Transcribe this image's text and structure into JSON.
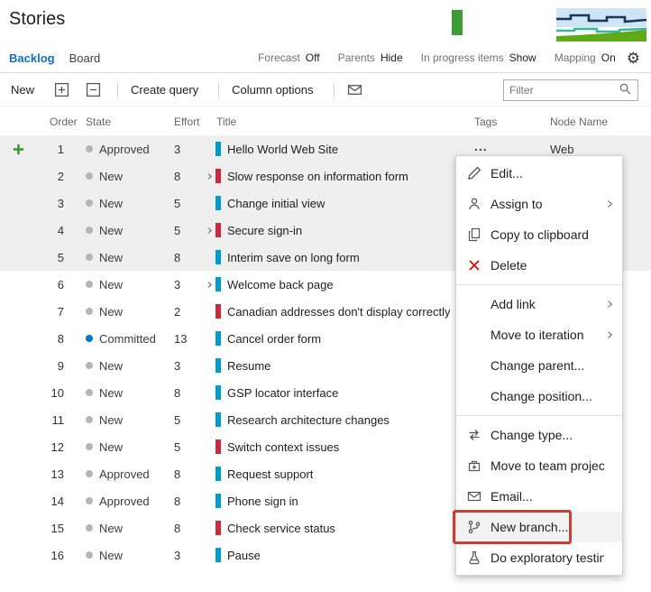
{
  "header": {
    "title": "Stories",
    "tabs": [
      {
        "label": "Backlog",
        "active": true
      },
      {
        "label": "Board",
        "active": false
      }
    ],
    "view_options": [
      {
        "label": "Forecast",
        "value": "Off"
      },
      {
        "label": "Parents",
        "value": "Hide"
      },
      {
        "label": "In progress items",
        "value": "Show"
      },
      {
        "label": "Mapping",
        "value": "On"
      }
    ],
    "gear_icon": "settings-gear-icon",
    "mini_charts": [
      {
        "name": "velocity-mini-chart",
        "bar_color": "#3f9c35"
      },
      {
        "name": "cumulative-flow-mini-chart",
        "colors": [
          "#cfe4f5",
          "#16365c",
          "#33b8a0",
          "#60a917"
        ]
      }
    ]
  },
  "toolbar": {
    "items": [
      {
        "kind": "button",
        "label": "New",
        "name": "new-button"
      },
      {
        "kind": "icon",
        "glyph": "plus-box",
        "name": "expand-all-icon"
      },
      {
        "kind": "icon",
        "glyph": "minus-box",
        "name": "collapse-all-icon"
      },
      {
        "kind": "sep"
      },
      {
        "kind": "button",
        "label": "Create query",
        "name": "create-query-button"
      },
      {
        "kind": "sep"
      },
      {
        "kind": "button",
        "label": "Column options",
        "name": "column-options-button"
      },
      {
        "kind": "sep"
      },
      {
        "kind": "icon",
        "glyph": "email",
        "name": "email-icon"
      }
    ],
    "filter_placeholder": "Filter",
    "search_icon": "search-icon"
  },
  "grid": {
    "columns": [
      "Order",
      "State",
      "Effort",
      "Title",
      "Tags",
      "Node Name"
    ],
    "menu_trigger_label": "...",
    "rows": [
      {
        "order": "1",
        "state": "Approved",
        "state_kind": "gray",
        "effort": "3",
        "title": "Hello World Web Site",
        "type": "story",
        "expand": false,
        "selected": true,
        "node": "Web",
        "add_icon": true,
        "menu_trigger": true
      },
      {
        "order": "2",
        "state": "New",
        "state_kind": "gray",
        "effort": "8",
        "title": "Slow response on information form",
        "type": "bug",
        "expand": true,
        "selected": true
      },
      {
        "order": "3",
        "state": "New",
        "state_kind": "gray",
        "effort": "5",
        "title": "Change initial view",
        "type": "story",
        "expand": false,
        "selected": true
      },
      {
        "order": "4",
        "state": "New",
        "state_kind": "gray",
        "effort": "5",
        "title": "Secure sign-in",
        "type": "bug",
        "expand": true,
        "selected": true
      },
      {
        "order": "5",
        "state": "New",
        "state_kind": "gray",
        "effort": "8",
        "title": "Interim save on long form",
        "type": "story",
        "expand": false,
        "selected": true
      },
      {
        "order": "6",
        "state": "New",
        "state_kind": "gray",
        "effort": "3",
        "title": "Welcome back page",
        "type": "story",
        "expand": true,
        "selected": false
      },
      {
        "order": "7",
        "state": "New",
        "state_kind": "gray",
        "effort": "2",
        "title": "Canadian addresses don't display correctly",
        "type": "bug",
        "expand": false,
        "selected": false
      },
      {
        "order": "8",
        "state": "Committed",
        "state_kind": "blue",
        "effort": "13",
        "title": "Cancel order form",
        "type": "story",
        "expand": false,
        "selected": false
      },
      {
        "order": "9",
        "state": "New",
        "state_kind": "gray",
        "effort": "3",
        "title": "Resume",
        "type": "story",
        "expand": false,
        "selected": false
      },
      {
        "order": "10",
        "state": "New",
        "state_kind": "gray",
        "effort": "8",
        "title": "GSP locator interface",
        "type": "story",
        "expand": false,
        "selected": false
      },
      {
        "order": "11",
        "state": "New",
        "state_kind": "gray",
        "effort": "5",
        "title": "Research architecture changes",
        "type": "story",
        "expand": false,
        "selected": false
      },
      {
        "order": "12",
        "state": "New",
        "state_kind": "gray",
        "effort": "5",
        "title": "Switch context issues",
        "type": "bug",
        "expand": false,
        "selected": false
      },
      {
        "order": "13",
        "state": "Approved",
        "state_kind": "gray",
        "effort": "8",
        "title": "Request support",
        "type": "story",
        "expand": false,
        "selected": false
      },
      {
        "order": "14",
        "state": "Approved",
        "state_kind": "gray",
        "effort": "8",
        "title": "Phone sign in",
        "type": "story",
        "expand": false,
        "selected": false
      },
      {
        "order": "15",
        "state": "New",
        "state_kind": "gray",
        "effort": "8",
        "title": "Check service status",
        "type": "bug",
        "expand": false,
        "selected": false
      },
      {
        "order": "16",
        "state": "New",
        "state_kind": "gray",
        "effort": "3",
        "title": "Pause",
        "type": "story",
        "expand": false,
        "selected": false
      }
    ]
  },
  "context_menu": {
    "items": [
      {
        "label": "Edit...",
        "icon": "pencil"
      },
      {
        "label": "Assign to",
        "icon": "person",
        "submenu": true
      },
      {
        "label": "Copy to clipboard",
        "icon": "copy"
      },
      {
        "label": "Delete",
        "icon": "delete"
      },
      {
        "type": "separator"
      },
      {
        "label": "Add link",
        "submenu": true
      },
      {
        "label": "Move to iteration",
        "submenu": true
      },
      {
        "label": "Change parent..."
      },
      {
        "label": "Change position..."
      },
      {
        "type": "separator"
      },
      {
        "label": "Change type...",
        "icon": "change-type"
      },
      {
        "label": "Move to team project...",
        "icon": "move-project"
      },
      {
        "label": "Email...",
        "icon": "email"
      },
      {
        "label": "New branch...",
        "icon": "branch",
        "highlighted": true,
        "annotated": true
      },
      {
        "label": "Do exploratory testing",
        "icon": "beaker"
      }
    ]
  },
  "colors": {
    "accent": "#106ebe",
    "story_bar": "#009ccc",
    "bug_bar": "#cc293d",
    "dot_gray": "#b5b5b5",
    "dot_blue": "#0078d7",
    "selection_bg": "#efefef",
    "annotation": "#cb3e33",
    "add_plus_green": "#339933"
  }
}
